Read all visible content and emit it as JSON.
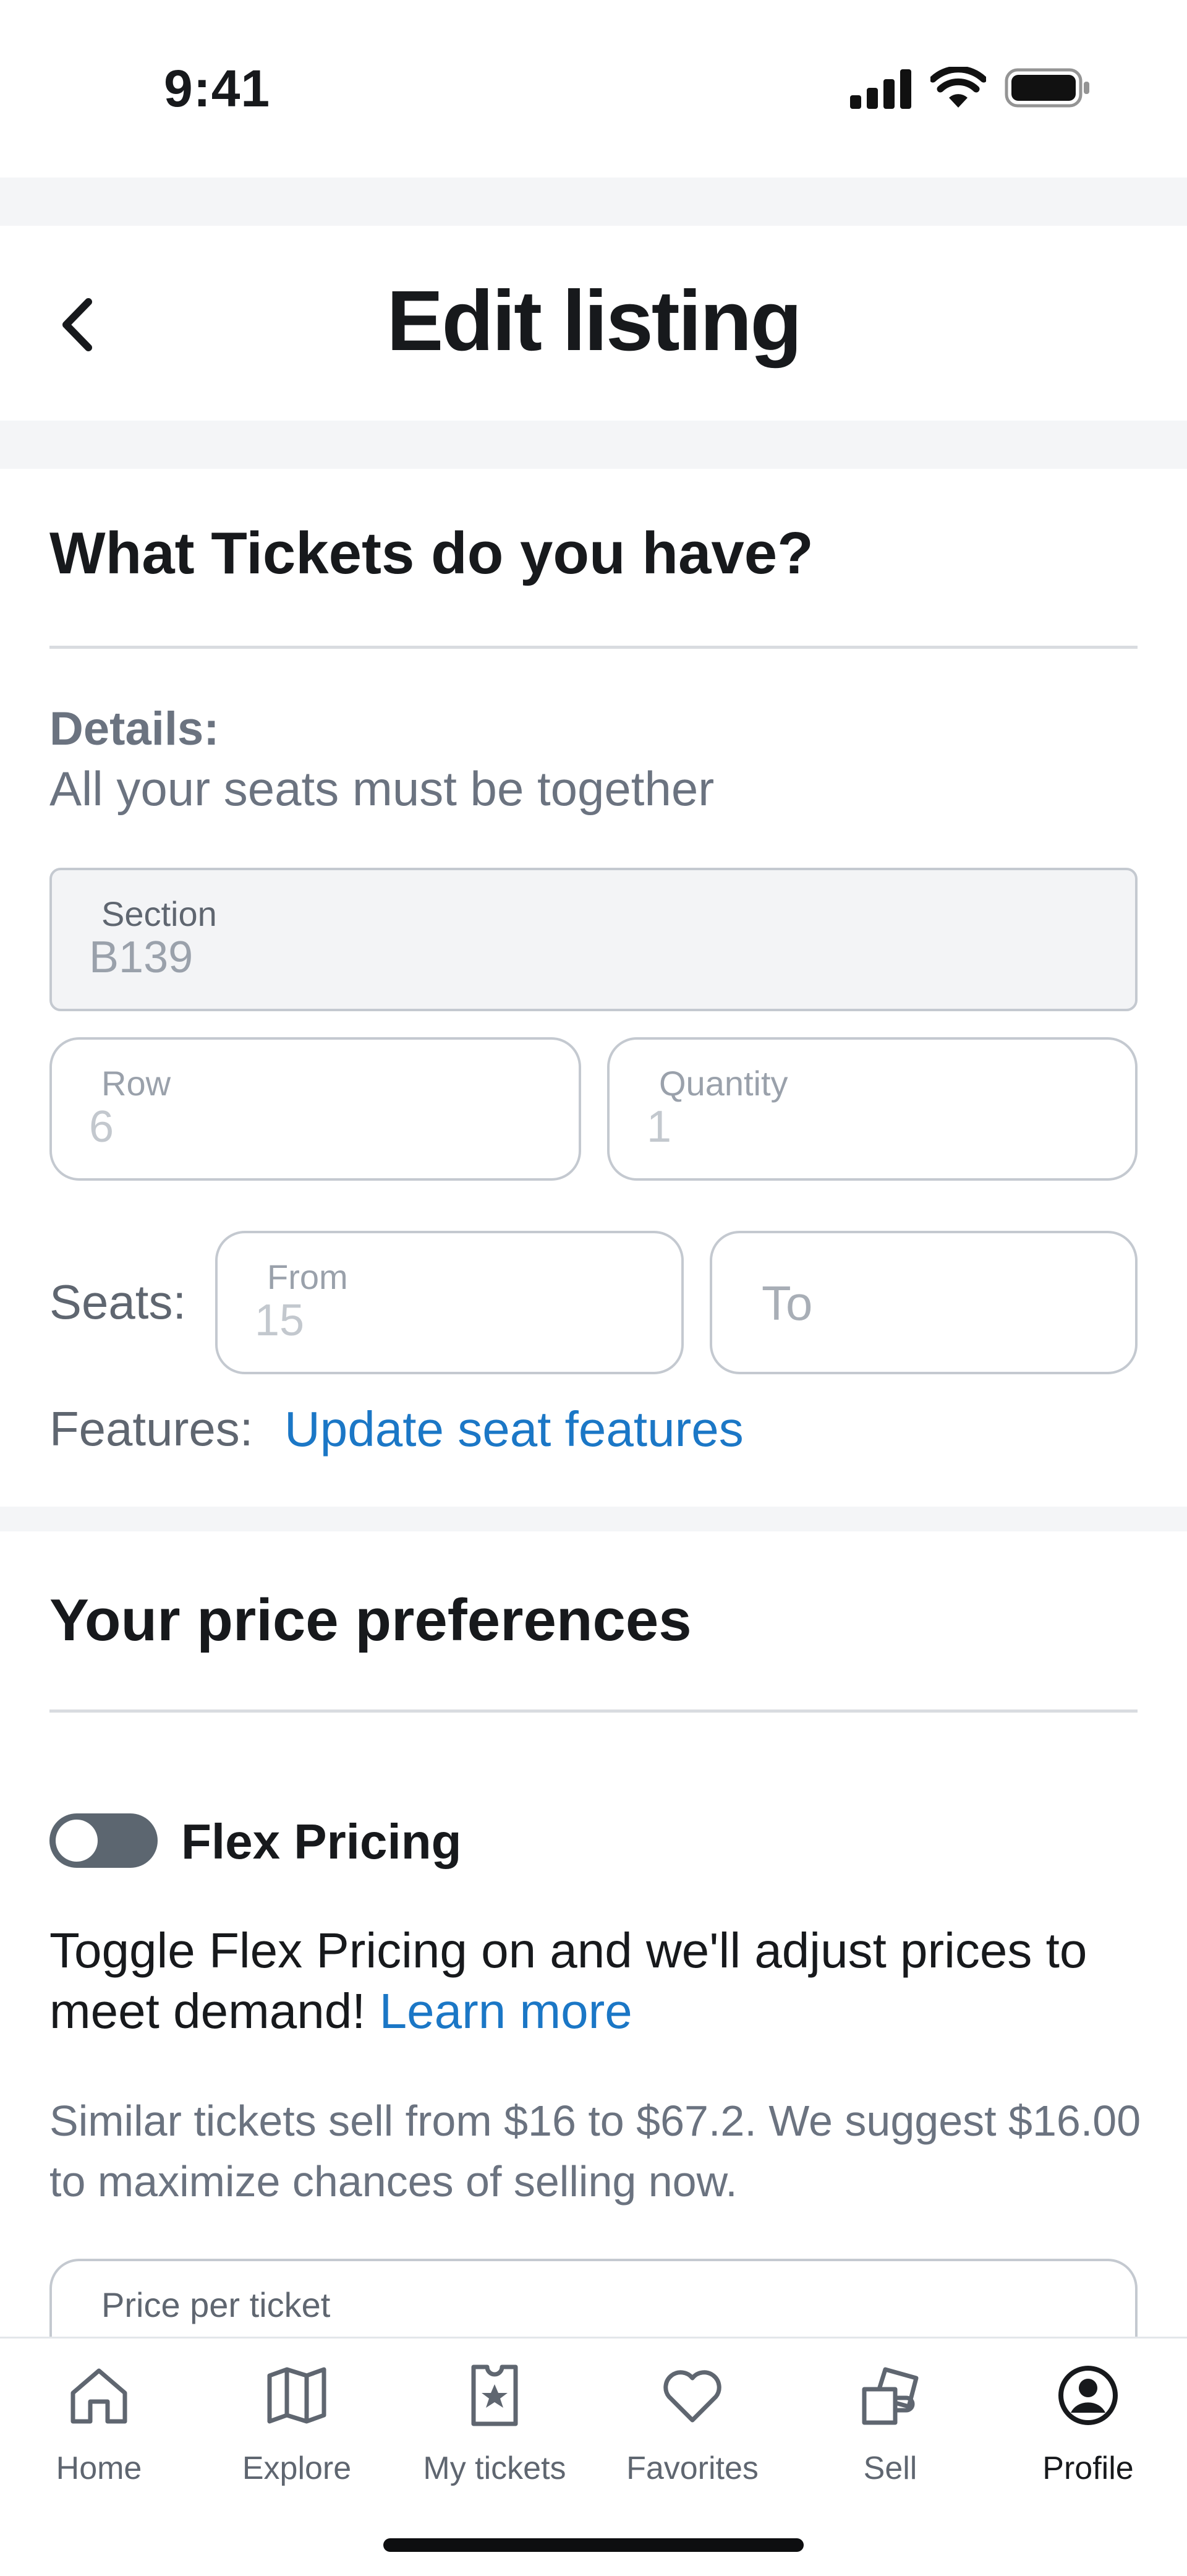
{
  "status_bar": {
    "time": "9:41"
  },
  "header": {
    "title": "Edit listing"
  },
  "tickets": {
    "heading": "What Tickets do you have?",
    "details_label": "Details:",
    "details_sub": "All your seats must be together",
    "section": {
      "label": "Section",
      "value": "B139"
    },
    "row": {
      "label": "Row",
      "value": "6"
    },
    "quantity": {
      "label": "Quantity",
      "value": "1"
    },
    "seats_label": "Seats:",
    "seat_from": {
      "label": "From",
      "value": "15"
    },
    "seat_to": {
      "placeholder": "To"
    },
    "features_label": "Features:",
    "features_link": "Update seat features"
  },
  "price": {
    "heading": "Your price preferences",
    "flex_label": "Flex Pricing",
    "flex_on": false,
    "flex_desc": "Toggle Flex Pricing on and we'll adjust prices to meet demand!",
    "learn_more": "Learn more",
    "suggestion": "Similar tickets sell from $16 to $67.2. We suggest $16.00 to maximize chances of selling now.",
    "price_label": "Price per ticket"
  },
  "tabs": [
    {
      "label": "Home",
      "icon": "home-icon"
    },
    {
      "label": "Explore",
      "icon": "map-icon"
    },
    {
      "label": "My tickets",
      "icon": "ticket-star-icon"
    },
    {
      "label": "Favorites",
      "icon": "heart-icon"
    },
    {
      "label": "Sell",
      "icon": "sell-ticket-icon"
    },
    {
      "label": "Profile",
      "icon": "profile-icon",
      "active": true
    }
  ],
  "colors": {
    "link": "#1b77c6",
    "toggle_off": "#5c6670",
    "text_muted": "#6b7380"
  }
}
